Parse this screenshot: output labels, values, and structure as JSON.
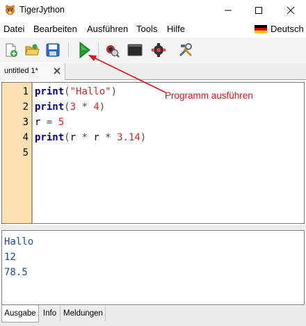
{
  "window": {
    "title": "TigerJython"
  },
  "menu": {
    "items": [
      "Datei",
      "Bearbeiten",
      "Ausführen",
      "Tools",
      "Hilfe"
    ],
    "language": "Deutsch"
  },
  "toolbar": {
    "buttons": [
      {
        "icon": "new-file-icon"
      },
      {
        "icon": "open-folder-icon"
      },
      {
        "icon": "save-icon"
      },
      {
        "icon": "run-icon"
      },
      {
        "icon": "debug-bug-icon"
      },
      {
        "icon": "console-icon"
      },
      {
        "icon": "robot-gear-icon"
      },
      {
        "icon": "tools-icon"
      }
    ]
  },
  "tab": {
    "label": "untitled 1*"
  },
  "editor": {
    "line_numbers": [
      "1",
      "2",
      "3",
      "4",
      "5"
    ],
    "lines": [
      [
        {
          "t": "print",
          "c": "kw"
        },
        {
          "t": "(",
          "c": "op"
        },
        {
          "t": "\"Hallo\"",
          "c": "str"
        },
        {
          "t": ")",
          "c": "op"
        }
      ],
      [
        {
          "t": "print",
          "c": "kw"
        },
        {
          "t": "(",
          "c": "op"
        },
        {
          "t": "3",
          "c": "num"
        },
        {
          "t": " * ",
          "c": "op"
        },
        {
          "t": "4",
          "c": "num"
        },
        {
          "t": ")",
          "c": "op"
        }
      ],
      [
        {
          "t": "r",
          "c": "id"
        },
        {
          "t": " = ",
          "c": "op"
        },
        {
          "t": "5",
          "c": "num"
        }
      ],
      [
        {
          "t": "print",
          "c": "kw"
        },
        {
          "t": "(",
          "c": "op"
        },
        {
          "t": "r",
          "c": "id"
        },
        {
          "t": " * ",
          "c": "op"
        },
        {
          "t": "r",
          "c": "id"
        },
        {
          "t": " * ",
          "c": "op"
        },
        {
          "t": "3.14",
          "c": "num"
        },
        {
          "t": ")",
          "c": "op"
        }
      ],
      []
    ]
  },
  "console": {
    "output": [
      "Hallo",
      "12",
      "78.5"
    ]
  },
  "bottom_tabs": {
    "ausgabe": "Ausgabe",
    "info": "Info",
    "meldungen": "Meldungen"
  },
  "annotation": {
    "text": "Programm  ausführen",
    "color": "#e0101a"
  }
}
